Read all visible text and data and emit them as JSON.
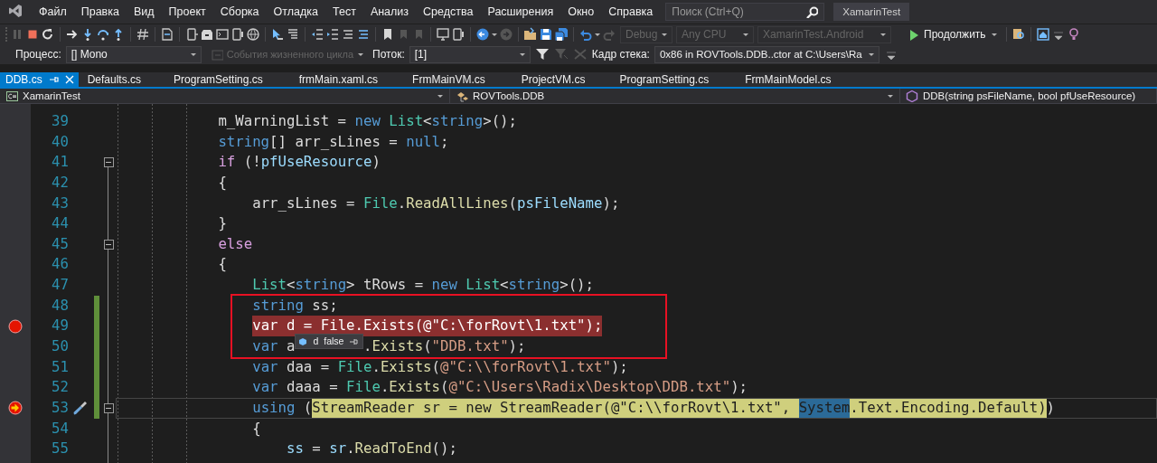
{
  "menu": {
    "items": [
      "Файл",
      "Правка",
      "Вид",
      "Проект",
      "Сборка",
      "Отладка",
      "Тест",
      "Анализ",
      "Средства",
      "Расширения",
      "Окно",
      "Справка"
    ]
  },
  "search": {
    "placeholder": "Поиск (Ctrl+Q)"
  },
  "solution_title": "XamarinTest",
  "toolbar": {
    "dropdowns": [
      {
        "value": "Debug",
        "disabled": true
      },
      {
        "value": "Any CPU",
        "disabled": true
      },
      {
        "value": "XamarinTest.Android",
        "disabled": true
      }
    ],
    "continue_button": "Продолжить"
  },
  "debug_location": {
    "process_label": "Процесс:",
    "process": "[] Mono",
    "lifecycle_events": {
      "label": "События жизненного цикла",
      "disabled": true
    },
    "thread_label": "Поток:",
    "thread": "[1]",
    "stack_frame_label": "Кадр стека:",
    "stack_frame": "0x86 in ROVTools.DDB..ctor at C:\\Users\\Ra"
  },
  "tabs": [
    {
      "label": "DDB.cs",
      "selected": true
    },
    {
      "label": "Defaults.cs",
      "selected": false
    },
    {
      "label": "ProgramSetting.cs",
      "selected": false
    },
    {
      "label": "frmMain.xaml.cs",
      "selected": false
    },
    {
      "label": "FrmMainVM.cs",
      "selected": false
    },
    {
      "label": "ProjectVM.cs",
      "selected": false
    },
    {
      "label": "ProgramSetting.cs",
      "selected": false
    },
    {
      "label": "FrmMainModel.cs",
      "selected": false
    }
  ],
  "navigation": {
    "project": "XamarinTest",
    "type": "ROVTools.DDB",
    "member": "DDB(string psFileName, bool pfUseResource)"
  },
  "editor": {
    "lines": [
      {
        "number": "39",
        "kind": "code",
        "fold": false,
        "changed": false,
        "boxed": false,
        "segments": [
          {
            "text": "m_WarningList = ",
            "kind": "plain"
          },
          {
            "text": "new ",
            "kind": "keyword"
          },
          {
            "text": "List",
            "kind": "type"
          },
          {
            "text": "<",
            "kind": "plain"
          },
          {
            "text": "string",
            "kind": "keyword"
          },
          {
            "text": ">();",
            "kind": "plain"
          }
        ]
      },
      {
        "number": "40",
        "kind": "code",
        "fold": false,
        "changed": false,
        "boxed": false,
        "segments": [
          {
            "text": "string",
            "kind": "keyword"
          },
          {
            "text": "[] arr_sLines = ",
            "kind": "plain"
          },
          {
            "text": "null",
            "kind": "keyword"
          },
          {
            "text": ";",
            "kind": "plain"
          }
        ]
      },
      {
        "number": "41",
        "kind": "code",
        "fold": true,
        "changed": false,
        "boxed": false,
        "segments": [
          {
            "text": "if",
            "kind": "control"
          },
          {
            "text": " (!",
            "kind": "plain"
          },
          {
            "text": "pfUseResource",
            "kind": "parameter"
          },
          {
            "text": ")",
            "kind": "plain"
          }
        ]
      },
      {
        "number": "42",
        "kind": "code",
        "fold": false,
        "changed": false,
        "boxed": false,
        "segments": [
          {
            "text": "{",
            "kind": "plain"
          }
        ]
      },
      {
        "number": "43",
        "kind": "code",
        "fold": false,
        "changed": false,
        "boxed": false,
        "segments": [
          {
            "text": "arr_sLines = ",
            "kind": "plain"
          },
          {
            "text": "File",
            "kind": "type"
          },
          {
            "text": ".",
            "kind": "plain"
          },
          {
            "text": "ReadAllLines",
            "kind": "method"
          },
          {
            "text": "(",
            "kind": "plain"
          },
          {
            "text": "psFileName",
            "kind": "parameter"
          },
          {
            "text": ");",
            "kind": "plain"
          }
        ]
      },
      {
        "number": "44",
        "kind": "code",
        "fold": false,
        "changed": false,
        "boxed": false,
        "segments": [
          {
            "text": "}",
            "kind": "plain"
          }
        ]
      },
      {
        "number": "45",
        "kind": "code",
        "fold": true,
        "changed": false,
        "boxed": false,
        "segments": [
          {
            "text": "else",
            "kind": "control"
          }
        ]
      },
      {
        "number": "46",
        "kind": "code",
        "fold": false,
        "changed": false,
        "boxed": false,
        "segments": [
          {
            "text": "{",
            "kind": "plain"
          }
        ]
      },
      {
        "number": "47",
        "kind": "code",
        "fold": false,
        "changed": false,
        "boxed": false,
        "segments": [
          {
            "text": "List",
            "kind": "type"
          },
          {
            "text": "<",
            "kind": "plain"
          },
          {
            "text": "string",
            "kind": "keyword"
          },
          {
            "text": "> tRows = ",
            "kind": "plain"
          },
          {
            "text": "new ",
            "kind": "keyword"
          },
          {
            "text": "List",
            "kind": "type"
          },
          {
            "text": "<",
            "kind": "plain"
          },
          {
            "text": "string",
            "kind": "keyword"
          },
          {
            "text": ">();",
            "kind": "plain"
          }
        ]
      },
      {
        "number": "48",
        "kind": "code",
        "fold": false,
        "changed": true,
        "boxed": true,
        "segments": [
          {
            "text": "string",
            "kind": "keyword"
          },
          {
            "text": " ss;",
            "kind": "plain"
          }
        ]
      },
      {
        "number": "49",
        "kind": "breakpoint",
        "fold": false,
        "changed": true,
        "boxed": true,
        "segments": [
          {
            "text": "var d = File.Exists(@\"C:\\forRovt\\1.txt\");",
            "kind": "breakpoint"
          }
        ]
      },
      {
        "number": "50",
        "kind": "code",
        "fold": false,
        "changed": true,
        "boxed": true,
        "segments": [
          {
            "text": "var",
            "kind": "keyword"
          },
          {
            "text": " a",
            "kind": "plain"
          },
          {
            "kind": "datatip",
            "name": "d",
            "value": "false"
          },
          {
            "text": ".",
            "kind": "plain"
          },
          {
            "text": "Exists",
            "kind": "method"
          },
          {
            "text": "(",
            "kind": "plain"
          },
          {
            "text": "\"DDB.txt\"",
            "kind": "string"
          },
          {
            "text": ");",
            "kind": "plain"
          }
        ]
      },
      {
        "number": "51",
        "kind": "code",
        "fold": false,
        "changed": true,
        "boxed": false,
        "segments": [
          {
            "text": "var",
            "kind": "keyword"
          },
          {
            "text": " daa = ",
            "kind": "plain"
          },
          {
            "text": "File",
            "kind": "type"
          },
          {
            "text": ".",
            "kind": "plain"
          },
          {
            "text": "Exists",
            "kind": "method"
          },
          {
            "text": "(",
            "kind": "plain"
          },
          {
            "text": "@\"C:\\\\forRovt\\1.txt\"",
            "kind": "string"
          },
          {
            "text": ");",
            "kind": "plain"
          }
        ]
      },
      {
        "number": "52",
        "kind": "code",
        "fold": false,
        "changed": true,
        "boxed": false,
        "segments": [
          {
            "text": "var",
            "kind": "keyword"
          },
          {
            "text": " daaa = ",
            "kind": "plain"
          },
          {
            "text": "File",
            "kind": "type"
          },
          {
            "text": ".",
            "kind": "plain"
          },
          {
            "text": "Exists",
            "kind": "method"
          },
          {
            "text": "(",
            "kind": "plain"
          },
          {
            "text": "@\"C:\\Users\\Radix\\Desktop\\DDB.txt\"",
            "kind": "string"
          },
          {
            "text": ");",
            "kind": "plain"
          }
        ]
      },
      {
        "number": "53",
        "kind": "current",
        "fold": true,
        "changed": true,
        "boxed": false,
        "segments": [
          {
            "text": "using",
            "kind": "keyword"
          },
          {
            "text": " (",
            "kind": "plain"
          },
          {
            "text": "StreamReader sr = new StreamReader(@\"C:\\\\forRovt\\1.txt\", ",
            "kind": "statement"
          },
          {
            "text": "System",
            "kind": "reference"
          },
          {
            "text": ".Text.Encoding.Default)",
            "kind": "statement"
          },
          {
            "text": ")",
            "kind": "plain"
          }
        ]
      },
      {
        "number": "54",
        "kind": "code",
        "fold": false,
        "changed": false,
        "boxed": false,
        "segments": [
          {
            "text": "{",
            "kind": "plain"
          }
        ]
      },
      {
        "number": "55",
        "kind": "code",
        "fold": false,
        "changed": false,
        "boxed": false,
        "segments": [
          {
            "text": "ss",
            "kind": "local"
          },
          {
            "text": " = ",
            "kind": "plain"
          },
          {
            "text": "sr",
            "kind": "local"
          },
          {
            "text": ".",
            "kind": "plain"
          },
          {
            "text": "ReadToEnd",
            "kind": "method"
          },
          {
            "text": "();",
            "kind": "plain"
          }
        ]
      }
    ]
  }
}
